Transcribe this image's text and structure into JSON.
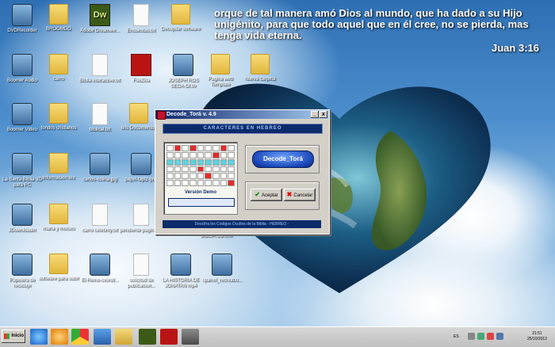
{
  "verse": {
    "text": "orque de tal manera amó Dios al mundo, que ha dado a su Hijo unigénito, para que todo aquel que en él cree, no se pierda, mas tenga vida eterna.",
    "reference": "Juan 3:16"
  },
  "desktop_icons": [
    {
      "label": "DVDRecorder",
      "type": "generic"
    },
    {
      "label": "BROOMDO",
      "type": "folder"
    },
    {
      "label": "Adobe Dreamwe...",
      "type": "dw"
    },
    {
      "label": "Encuestas.txt",
      "type": "doc"
    },
    {
      "label": "Decopilar software",
      "type": "folder"
    },
    {
      "label": "Boomer Audio",
      "type": "generic"
    },
    {
      "label": "carro",
      "type": "folder"
    },
    {
      "label": "Biblia interactive.txt",
      "type": "doc"
    },
    {
      "label": "FileZilla",
      "type": "fz"
    },
    {
      "label": "JOSEPH ROS SEGA-DI.flv",
      "type": "generic"
    },
    {
      "label": "Pagina web Template",
      "type": "folder"
    },
    {
      "label": "Nueva carpeta",
      "type": "folder"
    },
    {
      "label": "Boomer Video",
      "type": "generic"
    },
    {
      "label": "fondos cristianos",
      "type": "folder"
    },
    {
      "label": "biblical.txt",
      "type": "doc"
    },
    {
      "label": "Mis Documentos",
      "type": "folder"
    },
    {
      "label": "La Santa Biblia 3D para PC",
      "type": "generic"
    },
    {
      "label": "Informacion tex",
      "type": "folder"
    },
    {
      "label": "carlos-colina.jpg",
      "type": "generic"
    },
    {
      "label": "papel-tapiz-pmt",
      "type": "generic"
    },
    {
      "label": "JDownloader",
      "type": "generic"
    },
    {
      "label": "maria y moises",
      "type": "folder"
    },
    {
      "label": "carro celebrity.txt",
      "type": "doc"
    },
    {
      "label": "pendiente pagina.txt",
      "type": "doc"
    },
    {
      "label": "BIBLIA.CD.exe",
      "type": "generic"
    },
    {
      "label": "Papelera de reciclaje",
      "type": "generic"
    },
    {
      "label": "software para subir",
      "type": "folder"
    },
    {
      "label": "El-Reino-celesti...",
      "type": "generic"
    },
    {
      "label": "solicitud de publicacion...",
      "type": "doc"
    },
    {
      "label": "LA HISTORIA DE JONATAN mp4",
      "type": "generic"
    },
    {
      "label": "sparrel_recreabo...",
      "type": "generic"
    }
  ],
  "dialog": {
    "title": "Decode_Torá  v. 4.9",
    "banner": "CARACTERES EN HEBREO",
    "demo_label": "Versión Demo",
    "decode_button": "Decode_Torá",
    "ok_button": "Aceptar",
    "cancel_button": "Cancelar",
    "footer": "Descifra los Códigos Ocultos de la Biblia  - HEBREO -",
    "controls": {
      "minimize": "_",
      "close": "x"
    }
  },
  "taskbar": {
    "start_label": "Inicio",
    "language": "ES",
    "time": "21:51",
    "date": "25/10/2012"
  }
}
